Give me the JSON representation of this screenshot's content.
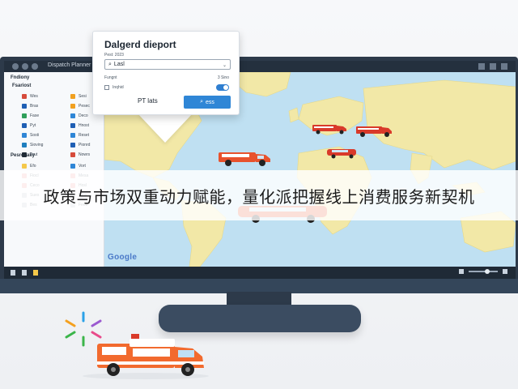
{
  "app": {
    "title": "Dispatch Planner"
  },
  "dialog": {
    "title": "Dalgerd dieport",
    "label": "Pest: 2023",
    "input_value": "Lasl",
    "row1_left": "Fungnt",
    "row1_right": "3 Sino",
    "row2_left": "Inqhid",
    "cancel_label": "PT lats",
    "primary_label": "ess"
  },
  "sidebar": {
    "section1": "Fndiony",
    "section1b": "Fsariost",
    "section2": "Pesrosaky",
    "items1": [
      {
        "label": "Wes",
        "color": "#d64b3b"
      },
      {
        "label": "Bras",
        "color": "#1f5fb4"
      },
      {
        "label": "Fase",
        "color": "#2f9f5a"
      },
      {
        "label": "Pyt",
        "color": "#1f5fb4"
      },
      {
        "label": "Sosti",
        "color": "#2f86d6"
      },
      {
        "label": "Sioving",
        "color": "#1f7fbf"
      },
      {
        "label": "Teut",
        "color": "#1f2a36"
      }
    ],
    "items1_right": [
      {
        "label": "Sesi",
        "color": "#f0a020"
      },
      {
        "label": "Pesec",
        "color": "#f0a020"
      },
      {
        "label": "Deco",
        "color": "#2f86d6"
      },
      {
        "label": "Hnost",
        "color": "#1f5fb4"
      },
      {
        "label": "Reset",
        "color": "#2f86d6"
      },
      {
        "label": "Pionrd",
        "color": "#1f5fb4"
      },
      {
        "label": "Nowrs",
        "color": "#d64b3b"
      }
    ],
    "items2": [
      {
        "label": "Efo",
        "color": "#f4c84a"
      },
      {
        "label": "Fiocl",
        "color": "#f4a0a0"
      },
      {
        "label": "Ceco",
        "color": "#f4a0a0"
      },
      {
        "label": "Sues",
        "color": "#c0c8d0"
      },
      {
        "label": "Bes",
        "color": "#c0c8d0"
      }
    ],
    "items2_right": [
      {
        "label": "Vort",
        "color": "#2f86d6"
      },
      {
        "label": "Mesa",
        "color": "#f4a0a0"
      },
      {
        "label": "Hosl",
        "color": "#f4a0a0"
      },
      {
        "label": "Bros",
        "color": "#c0c8d0"
      },
      {
        "label": "Fees",
        "color": "#c0c8d0"
      }
    ]
  },
  "map": {
    "attribution": "Google"
  },
  "banner": {
    "text": "政策与市场双重动力赋能，量化派把握线上消费服务新契机"
  }
}
